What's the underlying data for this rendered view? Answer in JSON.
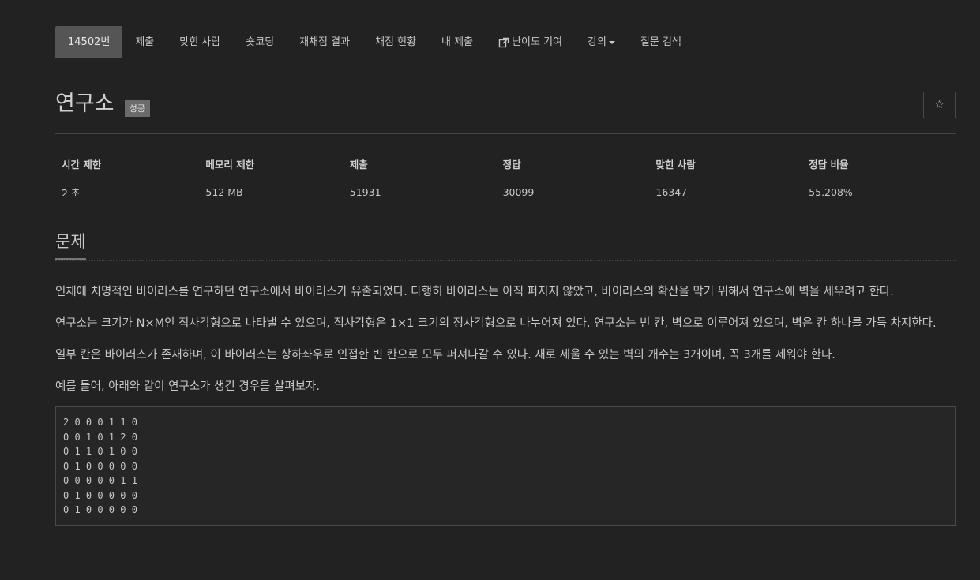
{
  "nav": {
    "items": [
      {
        "label": "14502번"
      },
      {
        "label": "제출"
      },
      {
        "label": "맞힌 사람"
      },
      {
        "label": "숏코딩"
      },
      {
        "label": "재채점 결과"
      },
      {
        "label": "채점 현황"
      },
      {
        "label": "내 제출"
      },
      {
        "label": "난이도 기여",
        "icon": "external-link-icon"
      },
      {
        "label": "강의",
        "icon": "caret-down-icon"
      },
      {
        "label": "질문 검색"
      }
    ]
  },
  "problem": {
    "title": "연구소",
    "badge": "성공",
    "star_icon": "☆"
  },
  "info": {
    "headers": [
      "시간 제한",
      "메모리 제한",
      "제출",
      "정답",
      "맞힌 사람",
      "정답 비율"
    ],
    "values": [
      "2 초",
      "512 MB",
      "51931",
      "30099",
      "16347",
      "55.208%"
    ]
  },
  "section": {
    "title": "문제",
    "paragraphs": [
      "인체에 치명적인 바이러스를 연구하던 연구소에서 바이러스가 유출되었다. 다행히 바이러스는 아직 퍼지지 않았고, 바이러스의 확산을 막기 위해서 연구소에 벽을 세우려고 한다.",
      "연구소는 크기가 N×M인 직사각형으로 나타낼 수 있으며, 직사각형은 1×1 크기의 정사각형으로 나누어져 있다. 연구소는 빈 칸, 벽으로 이루어져 있으며, 벽은 칸 하나를 가득 차지한다.",
      "일부 칸은 바이러스가 존재하며, 이 바이러스는 상하좌우로 인접한 빈 칸으로 모두 퍼져나갈 수 있다. 새로 세울 수 있는 벽의 개수는 3개이며, 꼭 3개를 세워야 한다.",
      "예를 들어, 아래와 같이 연구소가 생긴 경우를 살펴보자."
    ],
    "grid": "2 0 0 0 1 1 0\n0 0 1 0 1 2 0\n0 1 1 0 1 0 0\n0 1 0 0 0 0 0\n0 0 0 0 0 1 1\n0 1 0 0 0 0 0\n0 1 0 0 0 0 0"
  },
  "colors": {
    "background": "#222222",
    "active_nav": "#555555",
    "badge": "#6b6b6b"
  }
}
